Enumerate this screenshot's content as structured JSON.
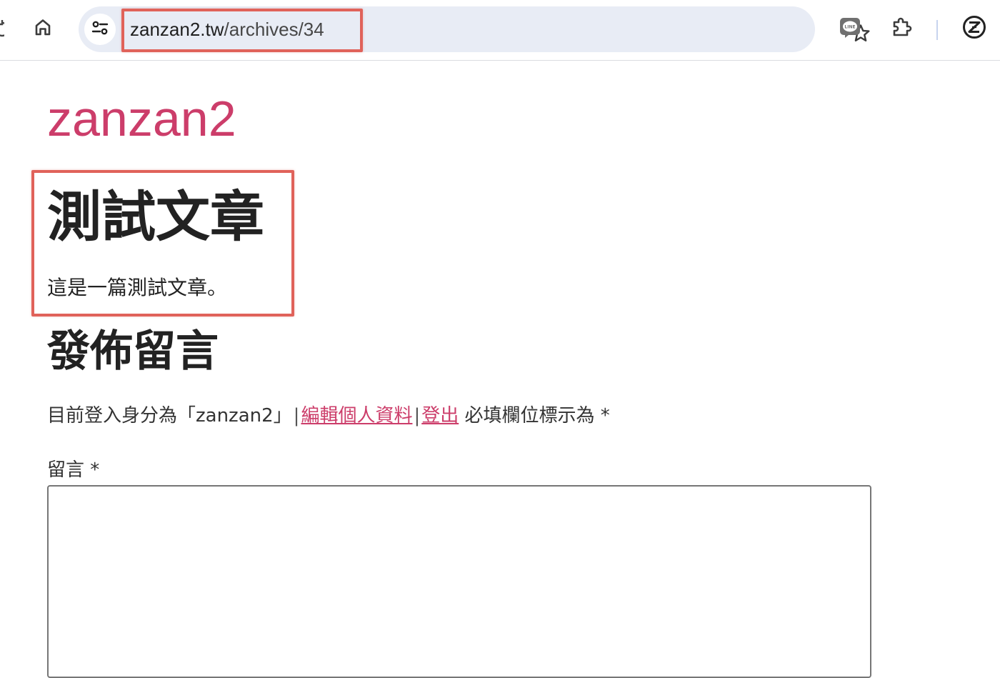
{
  "browser": {
    "url_host": "zanzan2.tw",
    "url_path": "/archives/34",
    "icons": {
      "home": "home-icon",
      "site_info": "tune-icon",
      "bookmark": "star-icon",
      "line_extension": "line-app-icon",
      "extensions": "puzzle-icon",
      "profile": "profile-avatar-icon"
    },
    "line_badge_text": "LINE"
  },
  "site": {
    "title": "zanzan2"
  },
  "article": {
    "title": "測試文章",
    "body": "這是一篇測試文章。"
  },
  "comments": {
    "reply_title": "發佈留言",
    "logged_in_prefix": "目前登入身分為「zanzan2」",
    "separator": "|",
    "edit_profile_link": "編輯個人資料",
    "logout_link": "登出",
    "required_note": "必填欄位標示為 *",
    "comment_label": "留言 *",
    "comment_value": ""
  },
  "colors": {
    "accent": "#cc3d6a",
    "highlight_box": "#e0625a",
    "omnibox_bg": "#e8ecf5"
  }
}
